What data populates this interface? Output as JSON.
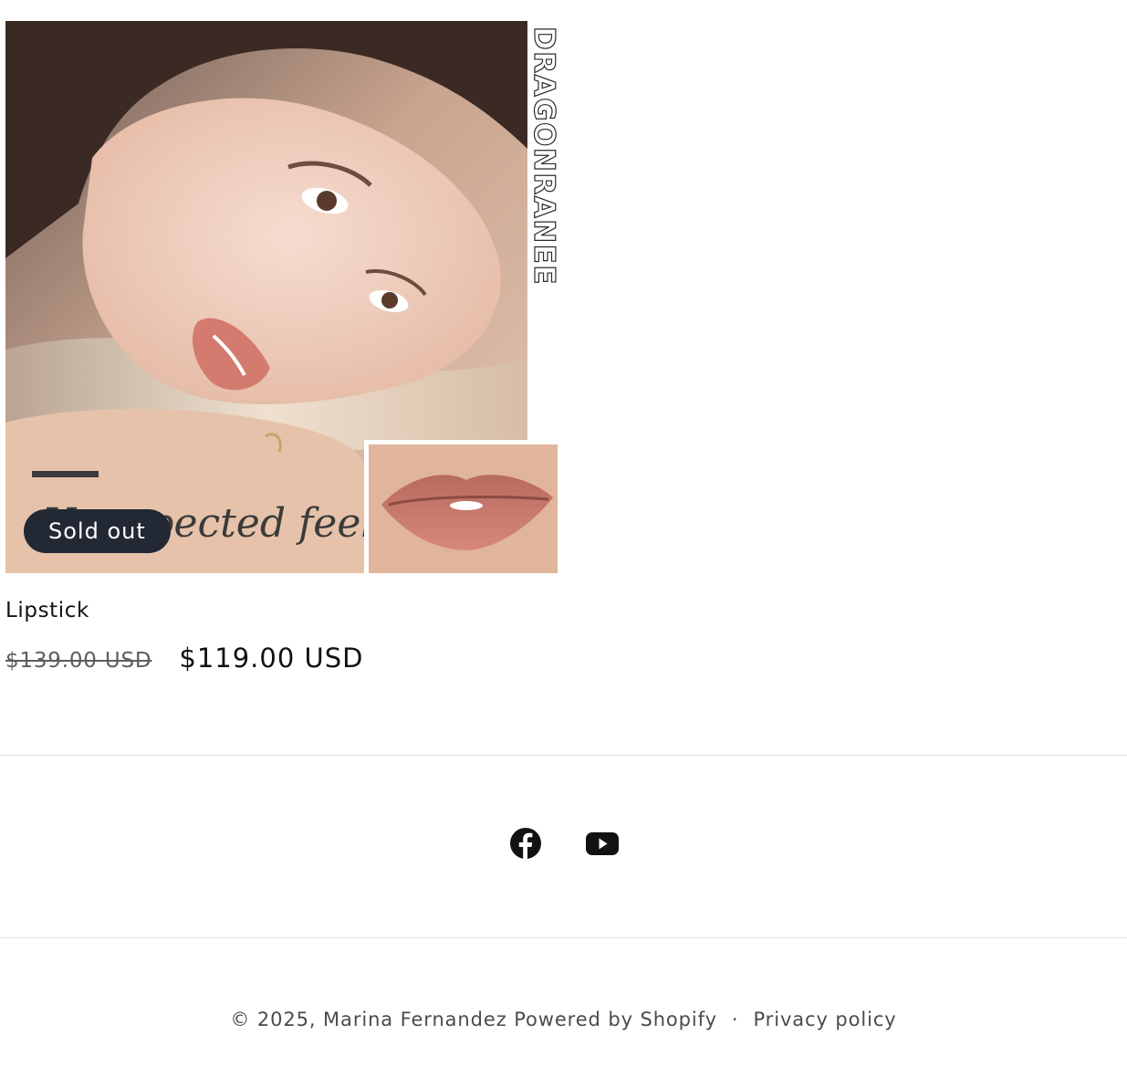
{
  "product": {
    "title": "Lipstick",
    "badge": "Sold out",
    "price_compare": "$139.00 USD",
    "price_sale": "$119.00 USD",
    "image": {
      "brand_text": "DRAGONRANEE",
      "caption_text": "Unexpected feeling"
    }
  },
  "social": {
    "items": [
      {
        "icon": "facebook-icon"
      },
      {
        "icon": "youtube-icon"
      }
    ]
  },
  "footer": {
    "copyright": "© 2025, ",
    "store_name": "Marina Fernandez",
    "powered_by": "Powered by Shopify",
    "separator": "·",
    "privacy_label": "Privacy policy"
  }
}
